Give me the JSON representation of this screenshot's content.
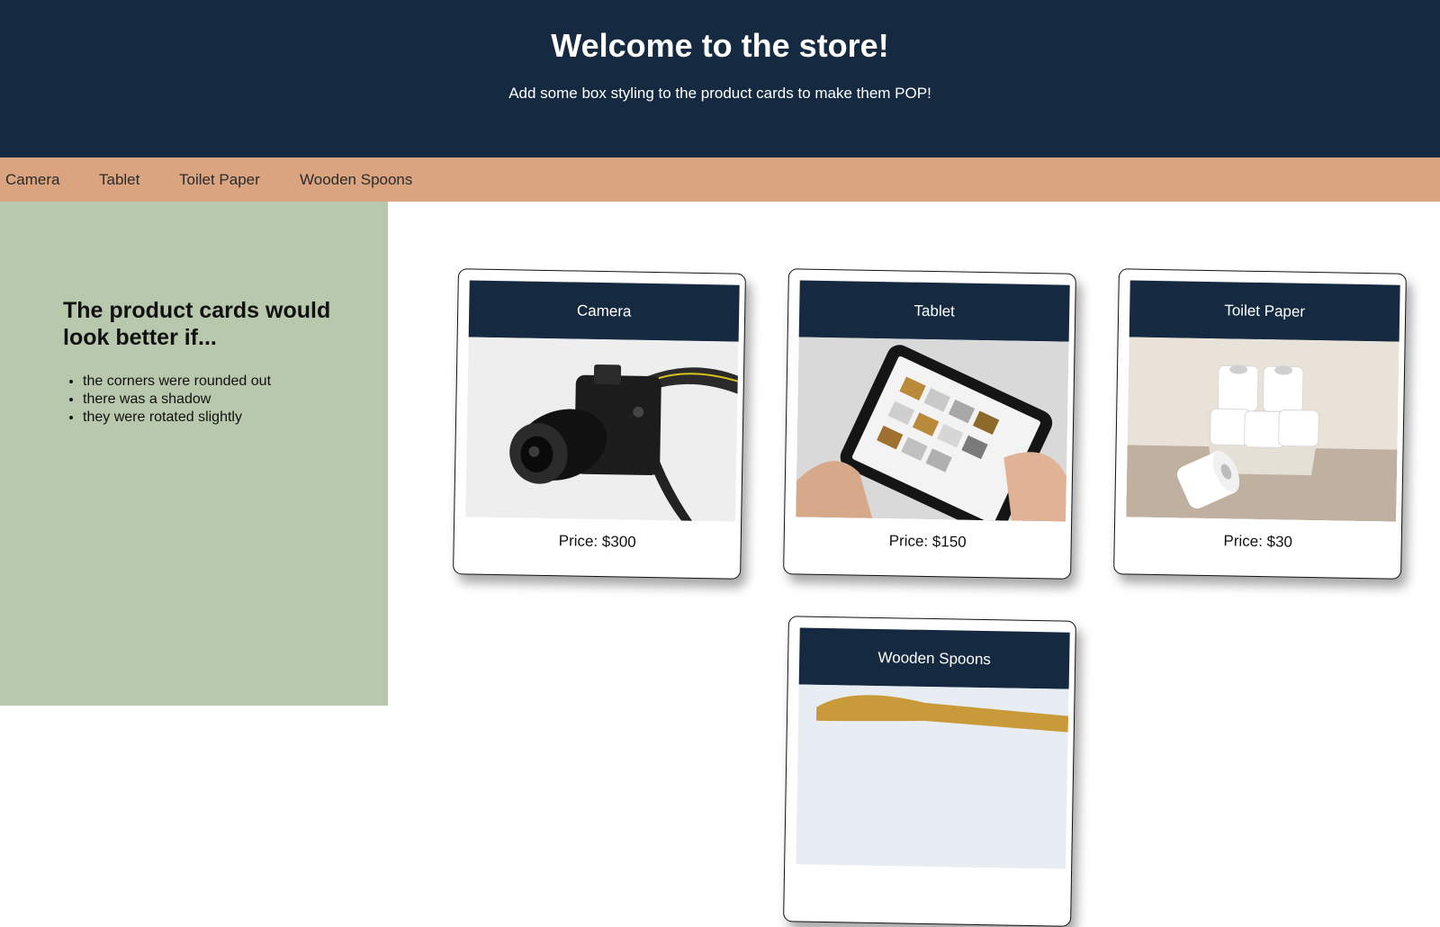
{
  "header": {
    "title": "Welcome to the store!",
    "subtitle": "Add some box styling to the product cards to make them POP!"
  },
  "nav": {
    "items": [
      {
        "label": "Camera"
      },
      {
        "label": "Tablet"
      },
      {
        "label": "Toilet Paper"
      },
      {
        "label": "Wooden Spoons"
      }
    ]
  },
  "sidebar": {
    "heading": "The product cards would look better if...",
    "tips": [
      "the corners were rounded out",
      "there was a shadow",
      "they were rotated slightly"
    ]
  },
  "products": [
    {
      "name": "Camera",
      "price": "Price: $300",
      "image": "camera-photo"
    },
    {
      "name": "Tablet",
      "price": "Price: $150",
      "image": "tablet-photo"
    },
    {
      "name": "Toilet Paper",
      "price": "Price: $30",
      "image": "toilet-paper-photo"
    },
    {
      "name": "Wooden Spoons",
      "price": "",
      "image": "wooden-spoons-photo"
    }
  ],
  "colors": {
    "header_bg": "#152a41",
    "nav_bg": "#d9a47f",
    "sidebar_bg": "#b8c8ad",
    "card_title_bg": "#152a41"
  }
}
